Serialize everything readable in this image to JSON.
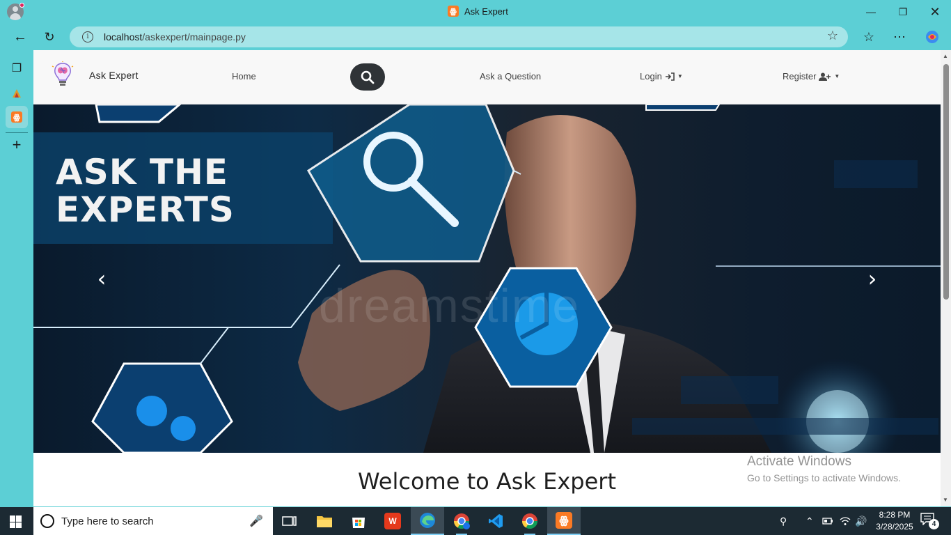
{
  "browser": {
    "tab_title": "Ask Expert",
    "url_host": "localhost",
    "url_path": "/askexpert/mainpage.py",
    "info_glyph": "i",
    "window_controls": [
      "minimize",
      "restore",
      "close"
    ]
  },
  "site": {
    "brand": "Ask Expert",
    "nav": {
      "home": "Home",
      "ask": "Ask a Question",
      "login": "Login",
      "register": "Register"
    },
    "hero": {
      "title_line1": "ASK THE",
      "title_line2": "EXPERTS",
      "watermark": "dreamstime"
    },
    "welcome_heading": "Welcome to Ask Expert"
  },
  "os_overlay": {
    "activate_title": "Activate Windows",
    "activate_sub": "Go to Settings to activate Windows."
  },
  "taskbar": {
    "search_placeholder": "Type here to search",
    "time": "8:28 PM",
    "date": "3/28/2025",
    "notification_count": "4"
  },
  "colors": {
    "browser_chrome": "#5ccfd5",
    "omnibox": "#a6e5e8",
    "navbar_bg": "#f8f8f8",
    "search_button": "#2f3337",
    "taskbar": "#1c2a33",
    "xampp_orange": "#fb7a24"
  }
}
